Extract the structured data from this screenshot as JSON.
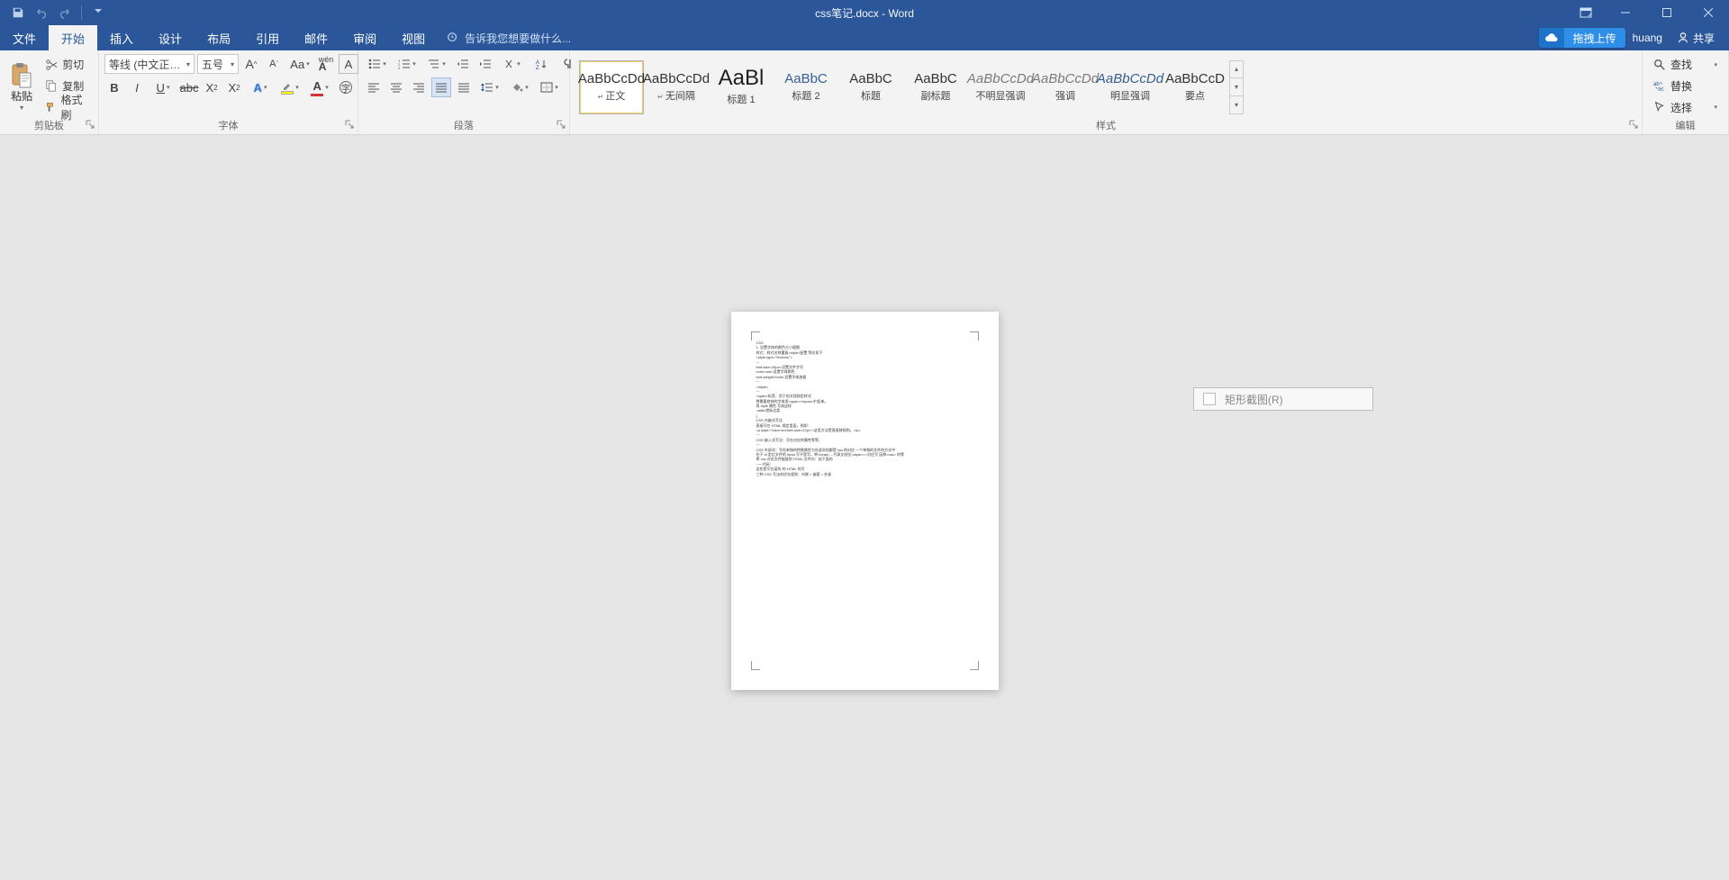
{
  "title": "css笔记.docx - Word",
  "tabs": {
    "file": "文件",
    "home": "开始",
    "insert": "插入",
    "design": "设计",
    "layout": "布局",
    "references": "引用",
    "mailings": "邮件",
    "review": "审阅",
    "view": "视图"
  },
  "tellme": "告诉我您想要做什么...",
  "upload": "拖拽上传",
  "username": "huang",
  "share": "共享",
  "clipboard": {
    "paste": "粘贴",
    "cut": "剪切",
    "copy": "复制",
    "painter": "格式刷",
    "label": "剪贴板"
  },
  "font": {
    "name": "等线 (中文正文)",
    "size": "五号",
    "label": "字体"
  },
  "paragraph": {
    "label": "段落"
  },
  "styles": {
    "label": "样式",
    "items": [
      {
        "k": "normal",
        "preview": "AaBbCcDd",
        "name": "正文",
        "arr": true,
        "cls": ""
      },
      {
        "k": "nospacing",
        "preview": "AaBbCcDd",
        "name": "无间隔",
        "arr": true,
        "cls": ""
      },
      {
        "k": "h1",
        "preview": "AaBl",
        "name": "标题 1",
        "cls": "big"
      },
      {
        "k": "h2",
        "preview": "AaBbC",
        "name": "标题 2",
        "cls": "blue"
      },
      {
        "k": "title",
        "preview": "AaBbC",
        "name": "标题",
        "cls": ""
      },
      {
        "k": "subtitle",
        "preview": "AaBbC",
        "name": "副标题",
        "cls": ""
      },
      {
        "k": "subtle",
        "preview": "AaBbCcDd",
        "name": "不明显强调",
        "cls": "grey"
      },
      {
        "k": "emphasis",
        "preview": "AaBbCcDd",
        "name": "强调",
        "cls": "grey"
      },
      {
        "k": "intense",
        "preview": "AaBbCcDd",
        "name": "明显强调",
        "cls": "grey blue"
      },
      {
        "k": "strong",
        "preview": "AaBbCcD",
        "name": "要点",
        "cls": ""
      }
    ]
  },
  "editing": {
    "find": "查找",
    "replace": "替换",
    "select": "选择",
    "label": "编辑"
  },
  "tooltip": "矩形截图(R)",
  "doc": {
    "lines": [
      "CSS",
      "1.   设置字体的颜色大小粗细",
      "     样式：样式名称重复<style>配置 等价如下",
      "     <style type=\"text/css\">",
      "",
      "font-size=20px=设置文件字号",
      "color=red=设置字体颜色",
      "font-weight=bold=设置字体加粗",
      "",
      "</style>",
      "",
      "<span>标签：用于给文段指定样式",
      "将需要修饰的字体用<span></span>扩起来。",
      "用 style 属性  写成这样",
      "    .caifa 就标志类",
      "}",
      "CSS 内嵌式写法",
      "直接写在 HTML 规定里面，例如：",
      "<p style=\"color:red;font-size=22px\">这里方法是直接按规则。</p>",
      "",
      "CSS 嵌入式写法：写在对应的属性等等；",
      "",
      "CSS 外部式：写在单独的特殊属性为外部文档都是 css 的对应 一个单独的文件的方式中",
      "在子 id 定位文件的 head 写不是写。将<head>…代表文档位<style>==对应写 因称<css> 的等",
      "将 css 对应文件链接到 HTML 文件内：加下面的",
      "代码：<link href=\"base.css\" rel=\"stylesheet\" type=\"text/css\" />",
      "这些是写在某的 的 HTML 的写",
      "三种 CSS 写法的优先规则：内联 > 嵌套 > 外部"
    ]
  }
}
